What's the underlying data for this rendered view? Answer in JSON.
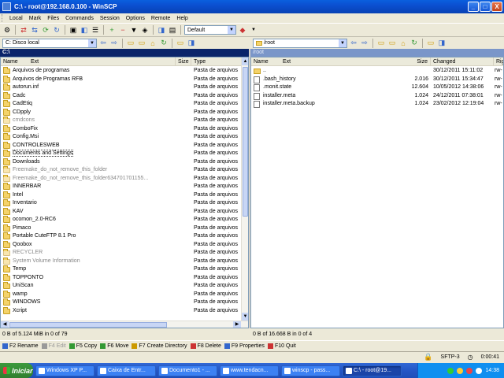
{
  "window": {
    "title": "C:\\ - root@192.168.0.100 - WinSCP",
    "controls": [
      "_",
      "□",
      "X"
    ]
  },
  "menu": [
    "Local",
    "Mark",
    "Files",
    "Commands",
    "Session",
    "Options",
    "Remote",
    "Help"
  ],
  "toolbar": {
    "transfer_setting": "Default"
  },
  "left": {
    "drive": "C: Disco local",
    "header": "C:\\",
    "columns": {
      "name": "Name",
      "ext": "Ext",
      "size": "Size",
      "type": "Type"
    },
    "rows": [
      {
        "name": "Arquivos de programas",
        "type": "Pasta de arquivos",
        "dim": false
      },
      {
        "name": "Arquivos de Programas RFB",
        "type": "Pasta de arquivos",
        "dim": false
      },
      {
        "name": "autorun.inf",
        "type": "Pasta de arquivos",
        "dim": false
      },
      {
        "name": "Cadc",
        "type": "Pasta de arquivos",
        "dim": false
      },
      {
        "name": "CadEtiq",
        "type": "Pasta de arquivos",
        "dim": false
      },
      {
        "name": "CDpply",
        "type": "Pasta de arquivos",
        "dim": false
      },
      {
        "name": "cmdcons",
        "type": "Pasta de arquivos",
        "dim": true
      },
      {
        "name": "ComboFix",
        "type": "Pasta de arquivos",
        "dim": false
      },
      {
        "name": "Config.Msi",
        "type": "Pasta de arquivos",
        "dim": false
      },
      {
        "name": "CONTROLESWEB",
        "type": "Pasta de arquivos",
        "dim": false
      },
      {
        "name": "Documents and Settings",
        "type": "Pasta de arquivos",
        "dim": false,
        "selected": true
      },
      {
        "name": "Downloads",
        "type": "Pasta de arquivos",
        "dim": false
      },
      {
        "name": "Freemake_do_not_remove_this_folder",
        "type": "Pasta de arquivos",
        "dim": true
      },
      {
        "name": "Freemake_do_not_remove_this_folder634701701155...",
        "type": "Pasta de arquivos",
        "dim": true
      },
      {
        "name": "INNERBAR",
        "type": "Pasta de arquivos",
        "dim": false
      },
      {
        "name": "Intel",
        "type": "Pasta de arquivos",
        "dim": false
      },
      {
        "name": "Inventario",
        "type": "Pasta de arquivos",
        "dim": false
      },
      {
        "name": "KAV",
        "type": "Pasta de arquivos",
        "dim": false
      },
      {
        "name": "ocomon_2.0-RC6",
        "type": "Pasta de arquivos",
        "dim": false
      },
      {
        "name": "Pimaco",
        "type": "Pasta de arquivos",
        "dim": false
      },
      {
        "name": "Portable CuteFTP 8.1 Pro",
        "type": "Pasta de arquivos",
        "dim": false
      },
      {
        "name": "Qoobox",
        "type": "Pasta de arquivos",
        "dim": false
      },
      {
        "name": "RECYCLER",
        "type": "Pasta de arquivos",
        "dim": true
      },
      {
        "name": "System Volume Information",
        "type": "Pasta de arquivos",
        "dim": true
      },
      {
        "name": "Temp",
        "type": "Pasta de arquivos",
        "dim": false
      },
      {
        "name": "TOPPONTO",
        "type": "Pasta de arquivos",
        "dim": false
      },
      {
        "name": "UniScan",
        "type": "Pasta de arquivos",
        "dim": false
      },
      {
        "name": "wamp",
        "type": "Pasta de arquivos",
        "dim": false
      },
      {
        "name": "WINDOWS",
        "type": "Pasta de arquivos",
        "dim": false
      },
      {
        "name": "Xcript",
        "type": "Pasta de arquivos",
        "dim": false
      }
    ],
    "status": "0 B of 5.124 MiB in 0 of 79"
  },
  "right": {
    "path": "/root",
    "header": "/root",
    "columns": {
      "name": "Name",
      "ext": "Ext",
      "size": "Size",
      "changed": "Changed",
      "rights": "Rig"
    },
    "rows": [
      {
        "name": "..",
        "size": "",
        "changed": "30/12/2011 15:11:02",
        "rights": "rw-",
        "kind": "up"
      },
      {
        "name": ".bash_history",
        "size": "2.016",
        "changed": "30/12/2011 15:34:47",
        "rights": "rw-",
        "kind": "file"
      },
      {
        "name": ".monit.state",
        "size": "12.604",
        "changed": "10/05/2012 14:38:06",
        "rights": "rw-",
        "kind": "file"
      },
      {
        "name": "installer.meta",
        "size": "1.024",
        "changed": "24/12/2011 07:38:01",
        "rights": "rw-",
        "kind": "file"
      },
      {
        "name": "installer.meta.backup",
        "size": "1.024",
        "changed": "23/02/2012 12:19:04",
        "rights": "rw-",
        "kind": "file"
      }
    ],
    "status": "0 B of 16.668 B in 0 of 4"
  },
  "commands": [
    {
      "key": "F2",
      "label": "F2 Rename",
      "disabled": false
    },
    {
      "key": "F4",
      "label": "F4 Edit",
      "disabled": true
    },
    {
      "key": "F5",
      "label": "F5 Copy",
      "disabled": false
    },
    {
      "key": "F6",
      "label": "F6 Move",
      "disabled": false
    },
    {
      "key": "F7",
      "label": "F7 Create Directory",
      "disabled": false
    },
    {
      "key": "F8",
      "label": "F8 Delete",
      "disabled": false
    },
    {
      "key": "F9",
      "label": "F9 Properties",
      "disabled": false
    },
    {
      "key": "F10",
      "label": "F10 Quit",
      "disabled": false
    }
  ],
  "statusbar": {
    "protocol": "SFTP-3",
    "elapsed": "0:00:41"
  },
  "taskbar": {
    "start": "Iniciar",
    "tasks": [
      "Windows XP P...",
      "Caixa de Entr...",
      "Documento1 - ...",
      "www.tendacn...",
      "winscp - pass...",
      "C:\\ - root@19..."
    ],
    "clock": "14:38"
  },
  "colors": {
    "selected_header": "#0a246a",
    "folder": "#f4d36b",
    "titlebar": "#0b4fd0"
  }
}
